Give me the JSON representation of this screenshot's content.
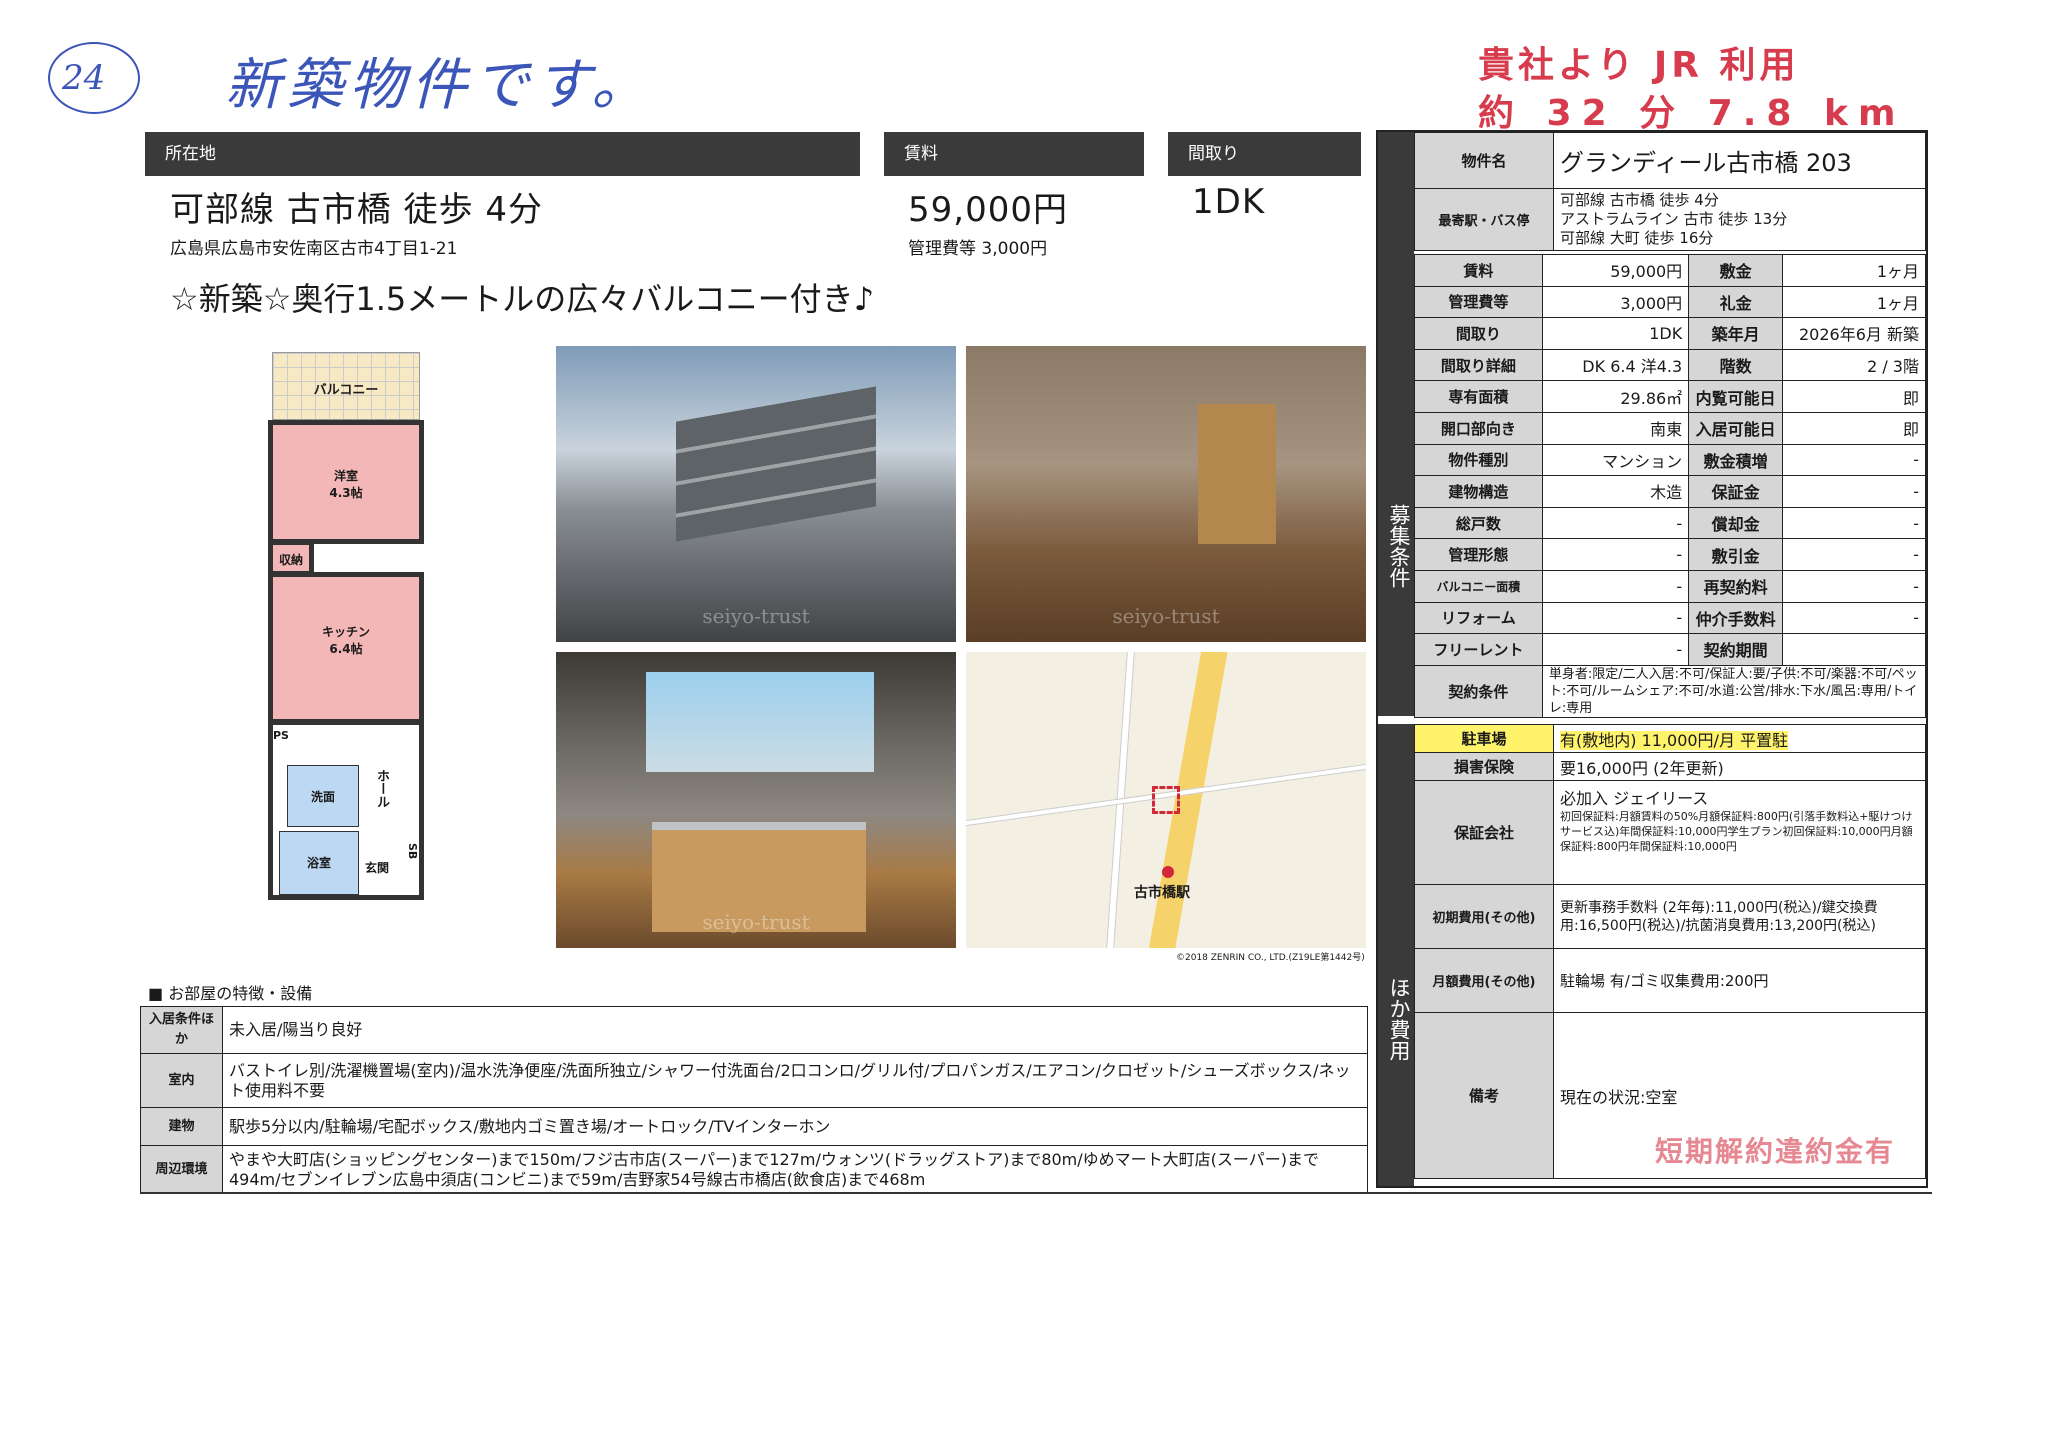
{
  "handwriting": {
    "number": "24",
    "note": "新築物件です。"
  },
  "stamp": {
    "line1": "貴社より JR 利用",
    "line2": "約 32 分 7.8 km",
    "bottom": "短期解約違約金有"
  },
  "header": {
    "location_label": "所在地",
    "rent_label": "賃料",
    "layout_label": "間取り"
  },
  "summary": {
    "access": "可部線 古市橋 徒歩 4分",
    "address": "広島県広島市安佐南区古市4丁目1-21",
    "rent": "59,000円",
    "mgmt_fee": "管理費等 3,000円",
    "layout": "1DK",
    "catch": "☆新築☆奥行1.5メートルの広々バルコニー付き♪"
  },
  "floorplan": {
    "balcony": "バルコニー",
    "western": "洋室",
    "western_size": "4.3帖",
    "storage": "収納",
    "kitchen": "キッチン",
    "kitchen_size": "6.4帖",
    "ps": "PS",
    "washroom": "洗面",
    "bath": "浴室",
    "hall": "ホール",
    "entrance": "玄関",
    "sb": "SB"
  },
  "photos": {
    "watermark": "seiyo-trust"
  },
  "map": {
    "station": "古市橋駅",
    "copyright": "©2018 ZENRIN CO., LTD.(Z19LE第1442号)"
  },
  "property": {
    "name_label": "物件名",
    "name": "グランディール古市橋 203",
    "station_label": "最寄駅・バス停",
    "stations": [
      "可部線 古市橋 徒歩 4分",
      "アストラムライン 古市 徒歩 13分",
      "可部線 大町 徒歩 16分"
    ],
    "sidebar1": "募集条件",
    "rows": [
      {
        "k1": "賃料",
        "v1": "59,000円",
        "k2": "敷金",
        "v2": "1ヶ月"
      },
      {
        "k1": "管理費等",
        "v1": "3,000円",
        "k2": "礼金",
        "v2": "1ヶ月"
      },
      {
        "k1": "間取り",
        "v1": "1DK",
        "k2": "築年月",
        "v2": "2026年6月 新築"
      },
      {
        "k1": "間取り詳細",
        "v1": "DK 6.4 洋4.3",
        "k2": "階数",
        "v2": "2 / 3階"
      },
      {
        "k1": "専有面積",
        "v1": "29.86㎡",
        "k2": "内覧可能日",
        "v2": "即"
      },
      {
        "k1": "開口部向き",
        "v1": "南東",
        "k2": "入居可能日",
        "v2": "即"
      },
      {
        "k1": "物件種別",
        "v1": "マンション",
        "k2": "敷金積増",
        "v2": "-"
      },
      {
        "k1": "建物構造",
        "v1": "木造",
        "k2": "保証金",
        "v2": "-"
      },
      {
        "k1": "総戸数",
        "v1": "-",
        "k2": "償却金",
        "v2": "-"
      },
      {
        "k1": "管理形態",
        "v1": "-",
        "k2": "敷引金",
        "v2": "-"
      },
      {
        "k1": "バルコニー面積",
        "v1": "-",
        "k2": "再契約料",
        "v2": "-"
      },
      {
        "k1": "リフォーム",
        "v1": "-",
        "k2": "仲介手数料",
        "v2": "-"
      },
      {
        "k1": "フリーレント",
        "v1": "-",
        "k2": "契約期間",
        "v2": ""
      }
    ],
    "contract_label": "契約条件",
    "contract": "単身者:限定/二人入居:不可/保証人:要/子供:不可/楽器:不可/ペット:不可/ルームシェア:不可/水道:公営/排水:下水/風呂:専用/トイレ:専用",
    "sidebar2": "ほか費用",
    "parking_label": "駐車場",
    "parking": "有(敷地内) 11,000円/月 平置駐",
    "insurance_label": "損害保険",
    "insurance": "要16,000円 (2年更新)",
    "guarantee_label": "保証会社",
    "guarantee_title": "必加入 ジェイリース",
    "guarantee_detail": "初回保証料:月額賃料の50%月額保証料:800円(引落手数料込+駆けつけサービス込)年間保証料:10,000円学生プラン初回保証料:10,000円月額保証料:800円年間保証料:10,000円",
    "initial_label": "初期費用(その他)",
    "initial": "更新事務手数料 (2年毎):11,000円(税込)/鍵交換費用:16,500円(税込)/抗菌消臭費用:13,200円(税込)",
    "monthly_label": "月額費用(その他)",
    "monthly": "駐輪場 有/ゴミ収集費用:200円",
    "remarks_label": "備考",
    "remarks": "現在の状況:空室"
  },
  "features": {
    "heading": "■ お部屋の特徴・設備",
    "rows": [
      {
        "k": "入居条件ほか",
        "v": "未入居/陽当り良好"
      },
      {
        "k": "室内",
        "v": "バストイレ別/洗濯機置場(室内)/温水洗浄便座/洗面所独立/シャワー付洗面台/2口コンロ/グリル付/プロパンガス/エアコン/クロゼット/シューズボックス/ネット使用料不要"
      },
      {
        "k": "建物",
        "v": "駅歩5分以内/駐輪場/宅配ボックス/敷地内ゴミ置き場/オートロック/TVインターホン"
      },
      {
        "k": "周辺環境",
        "v": "やまや大町店(ショッピングセンター)まで150m/フジ古市店(スーパー)まで127m/ウォンツ(ドラッグストア)まで80m/ゆめマート大町店(スーパー)まで494m/セブンイレブン広島中須店(コンビニ)まで59m/吉野家54号線古市橋店(飲食店)まで468m"
      }
    ]
  }
}
